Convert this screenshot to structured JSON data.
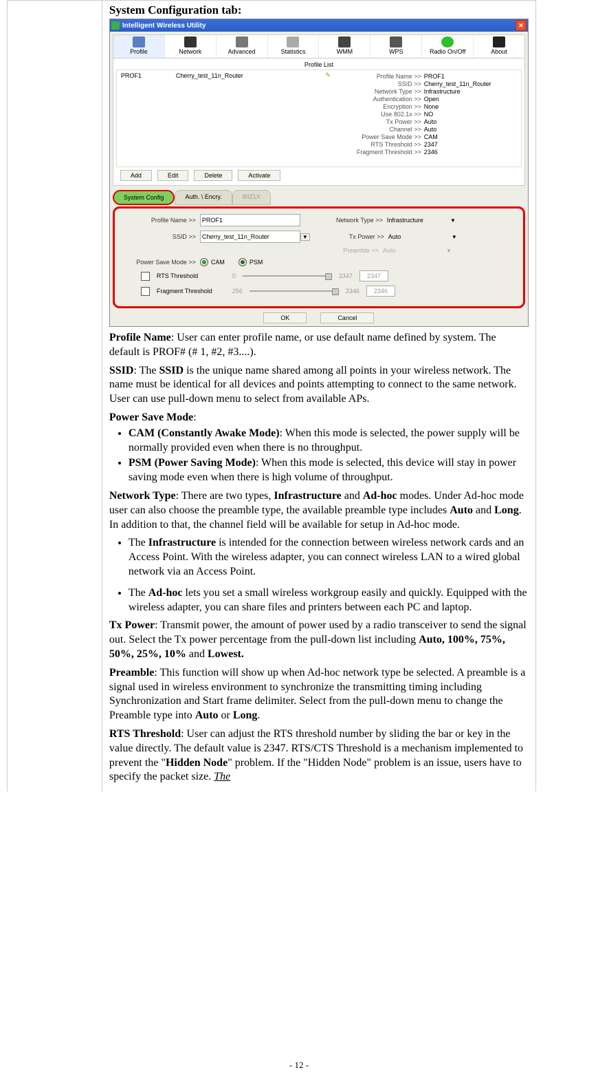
{
  "heading": "System Configuration tab:",
  "window": {
    "title": "Intelligent Wireless Utility",
    "tabs": [
      "Profile",
      "Network",
      "Advanced",
      "Statistics",
      "WMM",
      "WPS",
      "Radio On/Off",
      "About"
    ],
    "profile_list_header": "Profile List",
    "profile_row": {
      "name": "PROF1",
      "ssid": "Cherry_test_11n_Router"
    },
    "details": [
      {
        "k": "Profile Name >>",
        "v": "PROF1"
      },
      {
        "k": "SSID >>",
        "v": "Cherry_test_11n_Router"
      },
      {
        "k": "Network Type >>",
        "v": "Infrastructure"
      },
      {
        "k": "Authentication >>",
        "v": "Open"
      },
      {
        "k": "Encryption >>",
        "v": "None"
      },
      {
        "k": "Use 802.1x >>",
        "v": "NO"
      },
      {
        "k": "Tx Power >>",
        "v": "Auto"
      },
      {
        "k": "Channel >>",
        "v": "Auto"
      },
      {
        "k": "Power Save Mode >>",
        "v": "CAM"
      },
      {
        "k": "RTS Threshold >>",
        "v": "2347"
      },
      {
        "k": "Fragment Threshold >>",
        "v": "2346"
      }
    ],
    "buttons": [
      "Add",
      "Edit",
      "Delete",
      "Activate"
    ],
    "subtabs": {
      "sysconfig": "System Config",
      "auth": "Auth. \\ Encry.",
      "eight021x": "8021X"
    },
    "cfg": {
      "profile_label": "Profile Name >>",
      "profile_value": "PROF1",
      "ssid_label": "SSID >>",
      "ssid_value": "Cherry_test_11n_Router",
      "net_label": "Network Type >>",
      "net_value": "Infrastructure",
      "tx_label": "Tx Power >>",
      "tx_value": "Auto",
      "preamble_label": "Preamble >>",
      "preamble_value": "Auto",
      "psm_label": "Power Save Mode >>",
      "psm_cam": "CAM",
      "psm_psm": "PSM",
      "rts_label": "RTS Threshold",
      "rts_min": "0",
      "rts_max": "2347",
      "rts_val": "2347",
      "frag_label": "Fragment Threshold",
      "frag_min": "256",
      "frag_max": "2346",
      "frag_val": "2346",
      "ok": "OK",
      "cancel": "Cancel"
    }
  },
  "doc": {
    "p1a": "Profile Name",
    "p1b": ": User can enter profile name, or use default name defined by system. The default is PROF# (# 1, #2, #3....).",
    "p2a": "SSID",
    "p2b": ": The ",
    "p2c": "SSID",
    "p2d": " is the unique name shared among all points in your wireless network. The name must be identical for all devices and points attempting to connect to the same network. User can use pull-down menu to select from available APs.",
    "p3a": "Power Save Mode",
    "p3b": ":",
    "li1a": "CAM (Constantly Awake Mode)",
    "li1b": ": When this mode is selected, the power supply will be normally provided even when there is no throughput.",
    "li2a": "PSM (Power Saving Mode)",
    "li2b": ": When this mode is selected, this device will stay in power saving mode even when there is high volume of throughput.",
    "p4a": "Network Type",
    "p4b": ": There are two types, ",
    "p4c": "Infrastructure",
    "p4d": " and ",
    "p4e": "Ad-hoc",
    "p4f": " modes. Under Ad-hoc mode user can also choose the preamble type, the available preamble type includes ",
    "p4g": "Auto",
    "p4h": " and ",
    "p4i": "Long",
    "p4j": ". In addition to that, the channel field will be available for setup in Ad-hoc mode.",
    "li3a": "The ",
    "li3b": "Infrastructure",
    "li3c": " is intended for the connection between wireless network cards and an Access Point. With the wireless adapter, you can connect wireless LAN to a wired global network via an Access Point.",
    "li4a": "The ",
    "li4b": "Ad-hoc",
    "li4c": " lets you set a small wireless workgroup easily and quickly. Equipped with the wireless adapter, you can share files and printers between each PC and laptop.",
    "p5a": "Tx Power",
    "p5b": ": Transmit power, the amount of power used by a radio transceiver to send the signal out. Select the Tx power percentage from the pull-down list including ",
    "p5c": "Auto, 100%, 75%, 50%, 25%, 10%",
    "p5d": " and ",
    "p5e": "Lowest.",
    "p6a": "Preamble",
    "p6b": ": This function will show up when Ad-hoc network type be selected. A preamble is a signal used in wireless environment to synchronize the transmitting timing including Synchronization and Start frame delimiter. Select from the pull-down menu to change the Preamble type into ",
    "p6c": "Auto",
    "p6d": " or ",
    "p6e": "Long",
    "p6f": ".",
    "p7a": "RTS Threshold",
    "p7b": ": User can adjust the RTS threshold number by sliding the bar or key in the value directly. The default value is 2347. RTS/CTS Threshold is a mechanism implemented to prevent the \"",
    "p7c": "Hidden Node",
    "p7d": "\" problem. If the \"Hidden Node\" problem is an issue, users have to specify the packet size. ",
    "p7e": "The"
  },
  "pagenum": "- 12 -"
}
